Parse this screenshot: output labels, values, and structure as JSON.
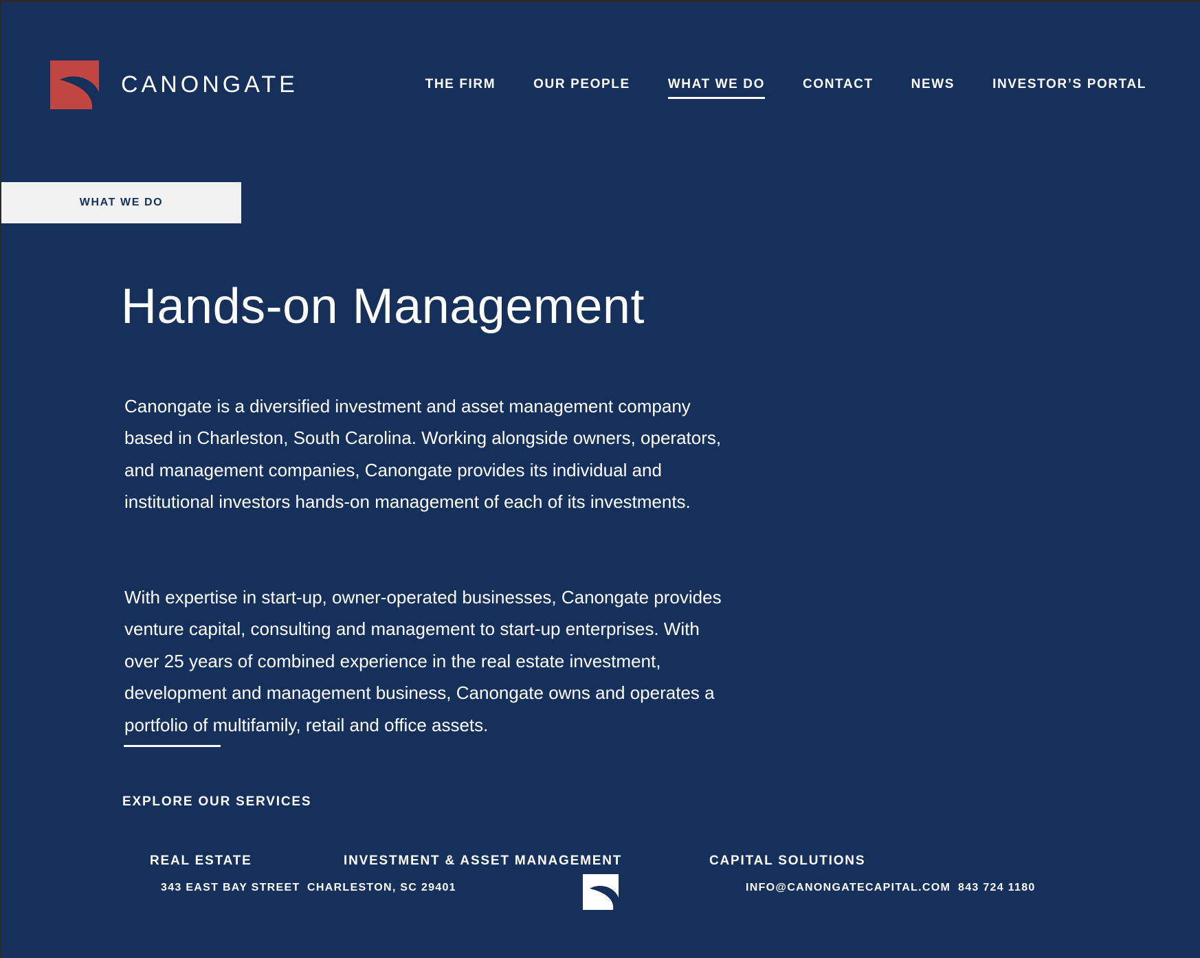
{
  "colors": {
    "background": "#15305a",
    "logo_red": "#c1463f",
    "tag_background": "#f2f2f3",
    "text": "#ffffff"
  },
  "header": {
    "logo_text": "CANONGATE",
    "logo_icon": "canongate-logo-icon",
    "nav": [
      {
        "label": "THE FIRM",
        "active": false
      },
      {
        "label": "OUR PEOPLE",
        "active": false
      },
      {
        "label": "WHAT WE DO",
        "active": true
      },
      {
        "label": "CONTACT",
        "active": false
      },
      {
        "label": "NEWS",
        "active": false
      },
      {
        "label": "INVESTOR’S PORTAL",
        "active": false
      }
    ]
  },
  "main": {
    "section_tag": "WHAT WE DO",
    "title": "Hands-on Management",
    "paragraphs": [
      "Canongate is a diversified investment and asset management company based in Charleston, South Carolina. Working alongside owners, operators, and management companies, Canongate provides its individual and institutional investors hands-on management of each of its investments.",
      "With expertise in start-up, owner-operated businesses, Canongate provides venture capital, consulting and management to start-up enterprises. With over 25 years of combined experience in the real estate investment, development and management business, Canongate owns and operates a portfolio of multifamily, retail and office assets."
    ],
    "explore_heading": "EXPLORE OUR SERVICES",
    "services": [
      "REAL ESTATE",
      "INVESTMENT & ASSET MANAGEMENT",
      "CAPITAL SOLUTIONS"
    ]
  },
  "footer": {
    "address": "343 EAST BAY STREET",
    "city": "CHARLESTON, SC 29401",
    "email": "INFO@CANONGATECAPITAL.COM",
    "phone": "843 724 1180",
    "mark_icon": "canongate-mark-icon"
  }
}
